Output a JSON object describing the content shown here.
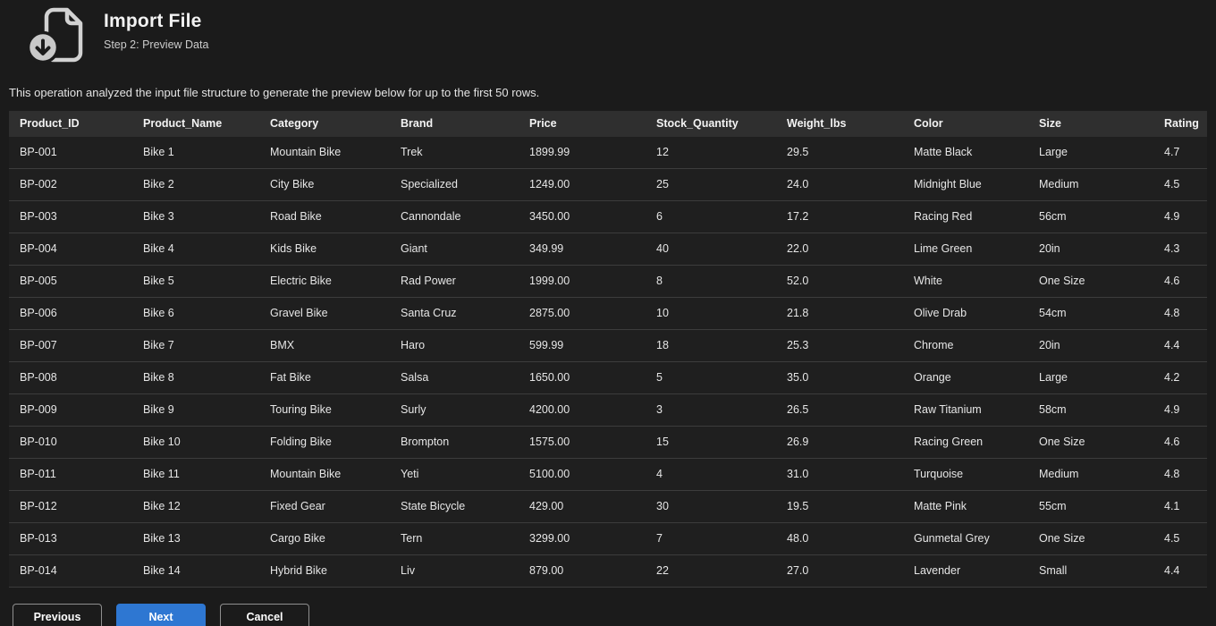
{
  "header": {
    "title": "Import File",
    "subtitle": "Step 2: Preview Data",
    "icon": "file-download-icon"
  },
  "description": "This operation analyzed the input file structure to generate the preview below for up to the first 50 rows.",
  "table": {
    "columns": [
      "Product_ID",
      "Product_Name",
      "Category",
      "Brand",
      "Price",
      "Stock_Quantity",
      "Weight_lbs",
      "Color",
      "Size",
      "Rating"
    ],
    "rows": [
      [
        "BP-001",
        "Bike 1",
        "Mountain Bike",
        "Trek",
        "1899.99",
        "12",
        "29.5",
        "Matte Black",
        "Large",
        "4.7"
      ],
      [
        "BP-002",
        "Bike 2",
        "City Bike",
        "Specialized",
        "1249.00",
        "25",
        "24.0",
        "Midnight Blue",
        "Medium",
        "4.5"
      ],
      [
        "BP-003",
        "Bike 3",
        "Road Bike",
        "Cannondale",
        "3450.00",
        "6",
        "17.2",
        "Racing Red",
        "56cm",
        "4.9"
      ],
      [
        "BP-004",
        "Bike 4",
        "Kids Bike",
        "Giant",
        "349.99",
        "40",
        "22.0",
        "Lime Green",
        "20in",
        "4.3"
      ],
      [
        "BP-005",
        "Bike 5",
        "Electric Bike",
        "Rad Power",
        "1999.00",
        "8",
        "52.0",
        "White",
        "One Size",
        "4.6"
      ],
      [
        "BP-006",
        "Bike 6",
        "Gravel Bike",
        "Santa Cruz",
        "2875.00",
        "10",
        "21.8",
        "Olive Drab",
        "54cm",
        "4.8"
      ],
      [
        "BP-007",
        "Bike 7",
        "BMX",
        "Haro",
        "599.99",
        "18",
        "25.3",
        "Chrome",
        "20in",
        "4.4"
      ],
      [
        "BP-008",
        "Bike 8",
        "Fat Bike",
        "Salsa",
        "1650.00",
        "5",
        "35.0",
        "Orange",
        "Large",
        "4.2"
      ],
      [
        "BP-009",
        "Bike 9",
        "Touring Bike",
        "Surly",
        "4200.00",
        "3",
        "26.5",
        "Raw Titanium",
        "58cm",
        "4.9"
      ],
      [
        "BP-010",
        "Bike 10",
        "Folding Bike",
        "Brompton",
        "1575.00",
        "15",
        "26.9",
        "Racing Green",
        "One Size",
        "4.6"
      ],
      [
        "BP-011",
        "Bike 11",
        "Mountain Bike",
        "Yeti",
        "5100.00",
        "4",
        "31.0",
        "Turquoise",
        "Medium",
        "4.8"
      ],
      [
        "BP-012",
        "Bike 12",
        "Fixed Gear",
        "State Bicycle",
        "429.00",
        "30",
        "19.5",
        "Matte Pink",
        "55cm",
        "4.1"
      ],
      [
        "BP-013",
        "Bike 13",
        "Cargo Bike",
        "Tern",
        "3299.00",
        "7",
        "48.0",
        "Gunmetal Grey",
        "One Size",
        "4.5"
      ],
      [
        "BP-014",
        "Bike 14",
        "Hybrid Bike",
        "Liv",
        "879.00",
        "22",
        "27.0",
        "Lavender",
        "Small",
        "4.4"
      ]
    ]
  },
  "buttons": {
    "previous": "Previous",
    "next": "Next",
    "cancel": "Cancel"
  },
  "colors": {
    "accent": "#2e77d2",
    "page_background": "#1b1b1b",
    "header_row_background": "#2f2f2f",
    "row_background": "#1f1f1f",
    "row_separator": "#3c3c3c"
  }
}
